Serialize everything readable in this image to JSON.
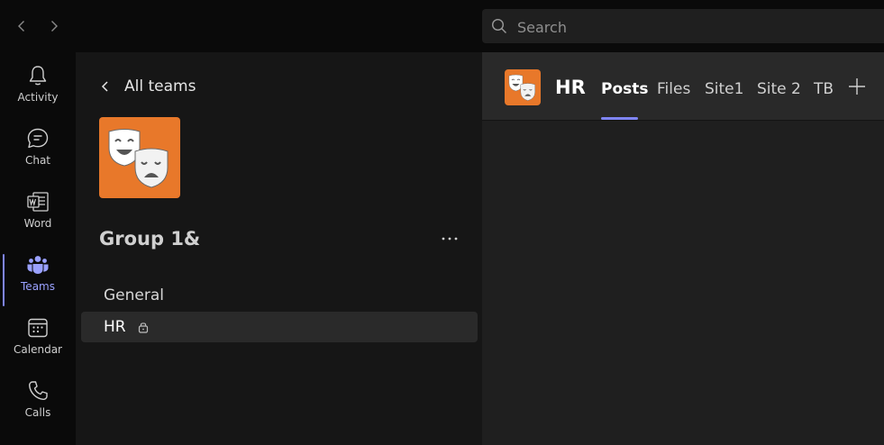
{
  "search": {
    "placeholder": "Search"
  },
  "rail": {
    "items": [
      {
        "label": "Activity",
        "icon": "bell-icon"
      },
      {
        "label": "Chat",
        "icon": "chat-icon"
      },
      {
        "label": "Word",
        "icon": "word-icon"
      },
      {
        "label": "Teams",
        "icon": "teams-icon",
        "active": true
      },
      {
        "label": "Calendar",
        "icon": "calendar-icon"
      },
      {
        "label": "Calls",
        "icon": "phone-icon"
      }
    ]
  },
  "teams_panel": {
    "back_label": "All teams",
    "team_name": "Group 1&",
    "channels": [
      {
        "label": "General"
      },
      {
        "label": "HR",
        "private": true,
        "selected": true
      }
    ]
  },
  "channel_header": {
    "title": "HR",
    "tabs": [
      {
        "label": "Posts",
        "active": true
      },
      {
        "label": "Files"
      },
      {
        "label": "Site1"
      },
      {
        "label": "Site 2"
      },
      {
        "label": "TB"
      }
    ]
  },
  "colors": {
    "accent": "#7f85f5",
    "team_logo_bg": "#e8782a",
    "rail_bg": "#0a0a0a",
    "panel_bg": "#161616",
    "main_bg": "#1f1f1f"
  }
}
